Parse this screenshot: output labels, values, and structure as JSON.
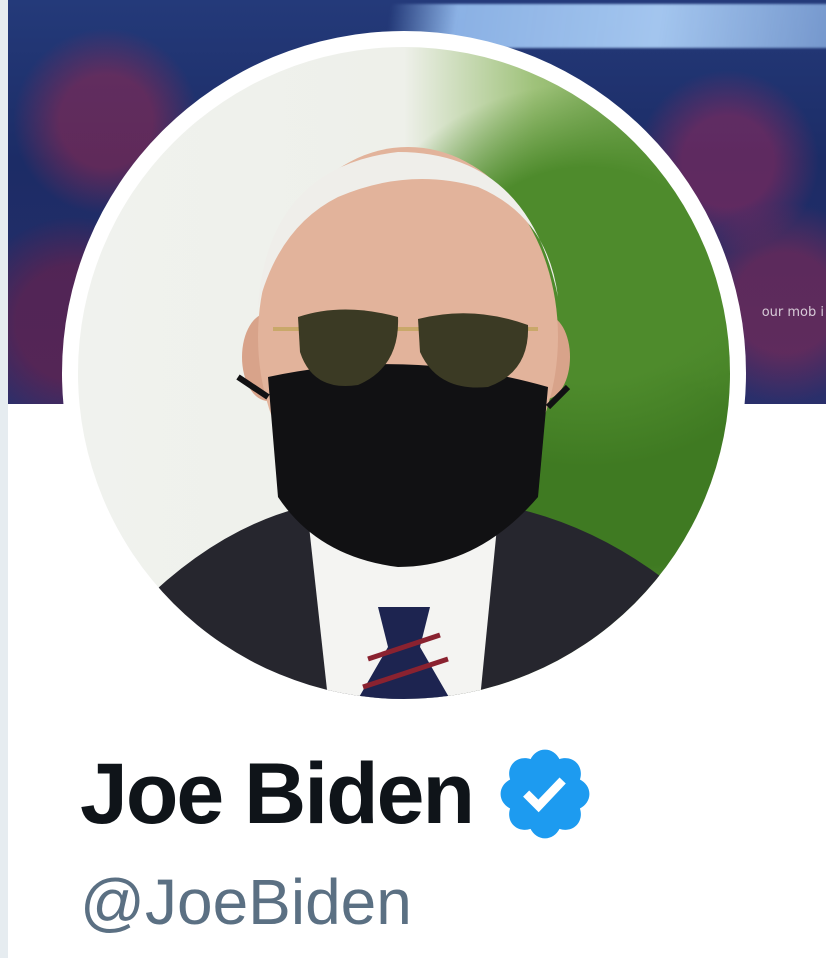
{
  "profile": {
    "display_name": "Joe Biden",
    "handle": "@JoeBiden",
    "verified": true
  },
  "header": {
    "banner_caption": "our mob i"
  },
  "icons": {
    "verified": "verified-badge-icon"
  },
  "colors": {
    "verified_blue": "#1d9bf0",
    "name_text": "#0f1419",
    "handle_text": "#5b7083",
    "banner_navy": "#1c2c66"
  }
}
